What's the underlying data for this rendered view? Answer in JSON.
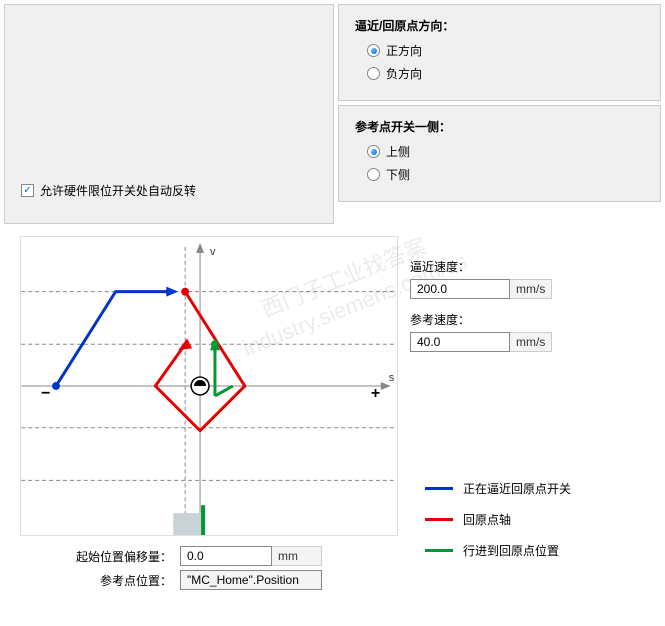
{
  "top": {
    "autoReverse": {
      "label": "允许硬件限位开关处自动反转",
      "checked": true
    },
    "direction": {
      "title": "逼近/回原点方向：",
      "options": [
        {
          "label": "正方向",
          "selected": true
        },
        {
          "label": "负方向",
          "selected": false
        }
      ]
    },
    "refSide": {
      "title": "参考点开关一侧：",
      "options": [
        {
          "label": "上侧",
          "selected": true
        },
        {
          "label": "下侧",
          "selected": false
        }
      ]
    }
  },
  "graph": {
    "vAxis": "v",
    "sAxis": "s",
    "minus": "−",
    "plus": "+"
  },
  "speeds": {
    "approachLabel": "逼近速度：",
    "approachValue": "200.0",
    "approachUnit": "mm/s",
    "refLabel": "参考速度：",
    "refValue": "40.0",
    "refUnit": "mm/s"
  },
  "legend": {
    "blue": "正在逼近回原点开关",
    "red": "回原点轴",
    "green": "行进到回原点位置"
  },
  "bottomFields": {
    "offsetLabel": "起始位置偏移量：",
    "offsetValue": "0.0",
    "offsetUnit": "mm",
    "refPosLabel": "参考点位置：",
    "refPosValue": "\"MC_Home\".Position"
  },
  "watermark": "西门子工业找答案\nindustry.siemens.com/cs"
}
